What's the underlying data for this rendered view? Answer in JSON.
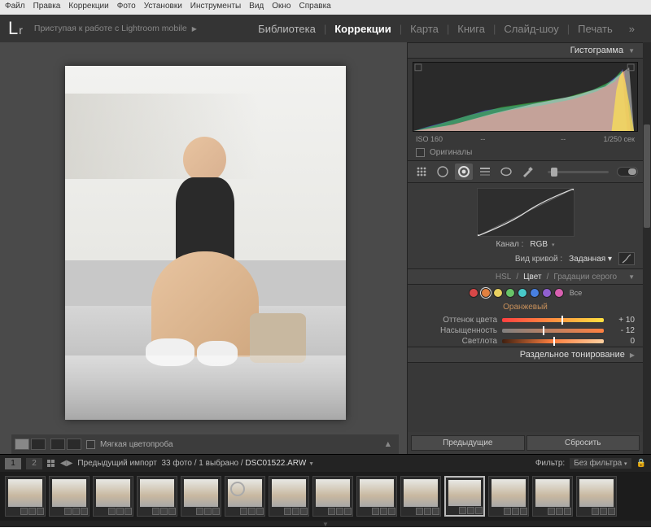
{
  "menu": [
    "Файл",
    "Правка",
    "Коррекции",
    "Фото",
    "Установки",
    "Инструменты",
    "Вид",
    "Окно",
    "Справка"
  ],
  "logo": {
    "L": "L",
    "r": "r",
    "text": "Приступая к работе с Lightroom mobile"
  },
  "modules": {
    "items": [
      "Библиотека",
      "Коррекции",
      "Карта",
      "Книга",
      "Слайд-шоу",
      "Печать"
    ],
    "active": 1
  },
  "panels": {
    "histogram_title": "Гистограмма",
    "histo_info": {
      "iso": "ISO 160",
      "shutter": "1/250 сек"
    },
    "originals": "Оригиналы",
    "channel_label": "Канал :",
    "channel_value": "RGB",
    "curve_type_label": "Вид кривой :",
    "curve_type_value": "Заданная",
    "hsl_tabs": [
      "HSL",
      "Цвет",
      "Градации серого"
    ],
    "hsl_active": 1,
    "hsl_all": "Все",
    "hsl_color_label": "Оранжевый",
    "hsl_colors": [
      "#d84848",
      "#e08040",
      "#e8d060",
      "#68c468",
      "#48c8c8",
      "#4880e0",
      "#9060d0",
      "#d860b0"
    ],
    "hue": {
      "label": "Оттенок цвета",
      "value": "+ 10",
      "pos": 58
    },
    "sat": {
      "label": "Насыщенность",
      "value": "- 12",
      "pos": 40
    },
    "lum": {
      "label": "Светлота",
      "value": "0",
      "pos": 50
    },
    "split_tone": "Раздельное тонирование",
    "prev_btn": "Предыдущие",
    "reset_btn": "Сбросить"
  },
  "preview_toolbar": {
    "softproof": "Мягкая цветопроба"
  },
  "filmstrip": {
    "nums": [
      "1",
      "2"
    ],
    "nav_label": "Предыдущий импорт",
    "count": "33 фото",
    "selected": "1 выбрано",
    "filename": "DSC01522.ARW",
    "filter_label": "Фильтр:",
    "filter_value": "Без фильтра",
    "thumb_count": 14,
    "sel_index": 10,
    "flagged_index": 5
  }
}
